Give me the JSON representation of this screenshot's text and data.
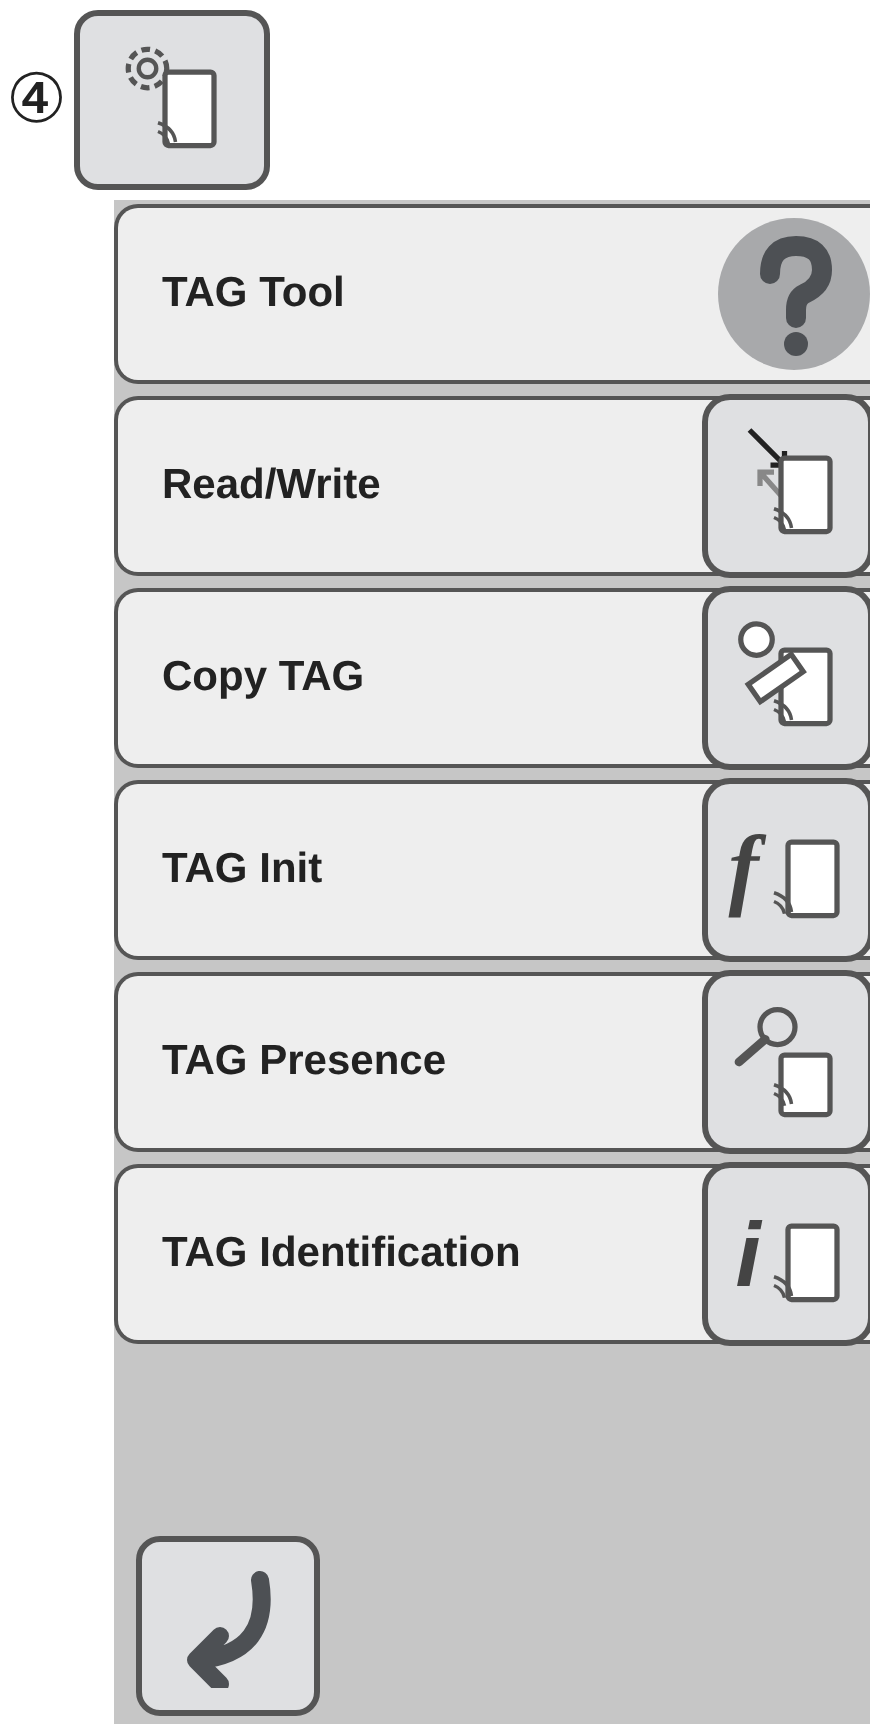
{
  "callout": "④",
  "menu_items": [
    {
      "label": "TAG Tool",
      "kind": "help"
    },
    {
      "label": "Read/Write",
      "kind": "tool"
    },
    {
      "label": "Copy TAG",
      "kind": "tool"
    },
    {
      "label": "TAG Init",
      "kind": "tool",
      "icon_glyph": "f"
    },
    {
      "label": "TAG Presence",
      "kind": "tool"
    },
    {
      "label": "TAG Identification",
      "kind": "tool",
      "icon_glyph": "i"
    }
  ]
}
